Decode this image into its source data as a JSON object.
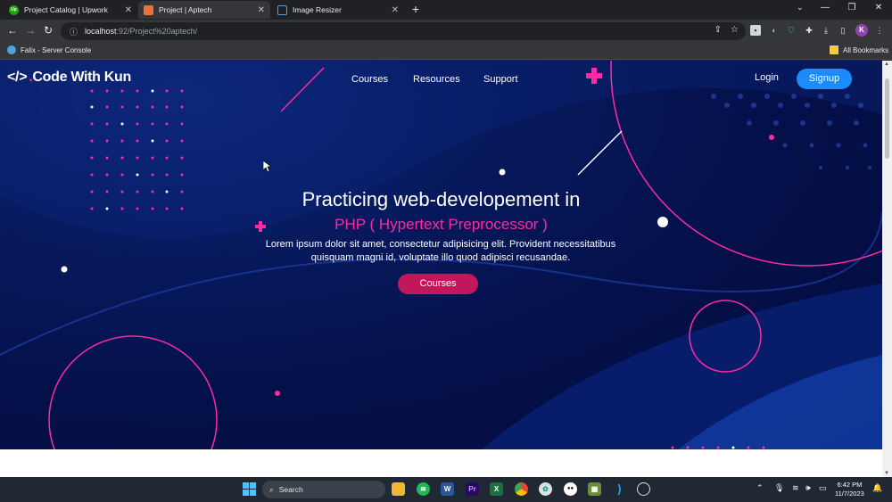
{
  "browser": {
    "tabs": [
      {
        "label": "Project Catalog | Upwork",
        "favicon": "upwork-icon",
        "color": "#14a800"
      },
      {
        "label": "Project | Aptech",
        "favicon": "project-icon",
        "color": "#e8733a"
      },
      {
        "label": "Image Resizer",
        "favicon": "resizer-icon",
        "color": "#5aa0d8"
      }
    ],
    "url_host": "localhost",
    "url_rest": ":92/Project%20aptech/",
    "bookmarks": [
      {
        "label": "Falix - Server Console"
      }
    ],
    "all_bookmarks": "All Bookmarks",
    "profile_initial": "K"
  },
  "site": {
    "logo": "Code With Kun",
    "logo_code": "</>",
    "nav": [
      "Courses",
      "Resources",
      "Support"
    ],
    "login": "Login",
    "signup": "Signup",
    "headline": "Practicing web-developement in",
    "subheadline": "PHP ( Hypertext Preprocessor )",
    "paragraph": "Lorem ipsum dolor sit amet, consectetur adipisicing elit. Provident necessitatibus quisquam magni id, voluptate illo quod adipisci recusandae.",
    "cta": "Courses",
    "colors": {
      "accent": "#ff2aa0",
      "primary_button": "#1a8cff",
      "cta": "#c2185b",
      "background": "#04104a"
    }
  },
  "taskbar": {
    "search": "Search",
    "time": "6:42 PM",
    "date": "11/7/2023"
  }
}
